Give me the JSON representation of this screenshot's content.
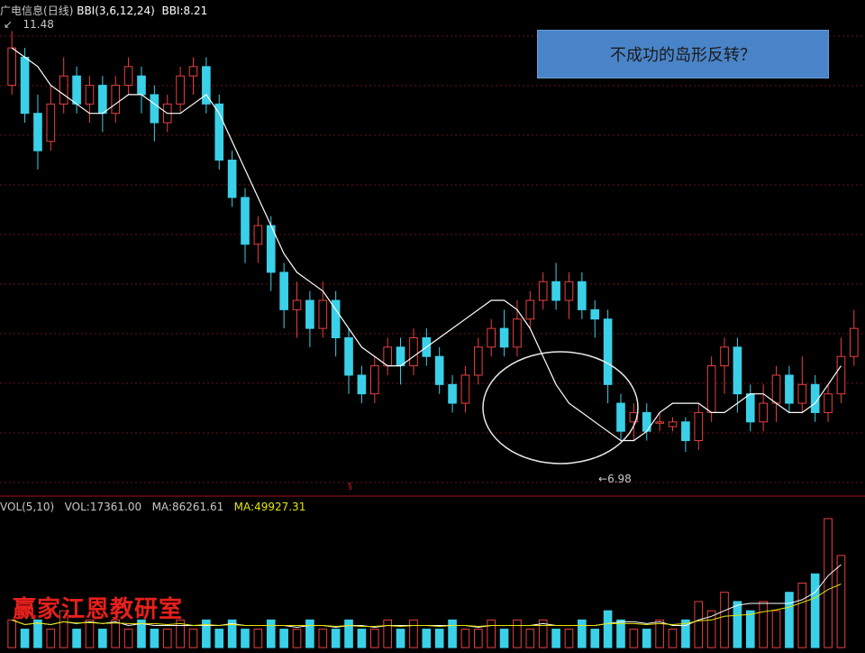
{
  "price_panel": {
    "stock_name": "广电信息",
    "period": "(日线)",
    "indicator": "BBI(3,6,12,24)",
    "bbi_label": "BBI:8.21",
    "high_marker": "11.48",
    "low_marker": "6.98"
  },
  "volume_panel": {
    "indicator": "VOL(5,10)",
    "vol_value": "VOL:17361.00",
    "ma1": "MA:86261.61",
    "ma2": "MA:49927.31",
    "panel_tag": "§"
  },
  "callout": {
    "text": "不成功的岛形反转？",
    "color": "#4a84c8"
  },
  "watermark": {
    "text": "赢家江恩教研室",
    "color": "#e8201c"
  },
  "colors": {
    "up": "#e84040",
    "down": "#3ad0e8",
    "bbi": "#ffffff",
    "grid": "#6a1515",
    "vol_ma1": "#ffffff",
    "vol_ma2": "#e6e600"
  },
  "chart_data": {
    "type": "candlestick",
    "title": "广电信息 (日线)",
    "y_range": [
      6.7,
      11.6
    ],
    "grid": true,
    "series": [
      {
        "name": "BBI",
        "values": [
          11.3,
          11.2,
          11.1,
          10.9,
          10.8,
          10.7,
          10.6,
          10.6,
          10.7,
          10.8,
          10.8,
          10.7,
          10.6,
          10.6,
          10.7,
          10.8,
          10.6,
          10.3,
          10.0,
          9.7,
          9.4,
          9.1,
          8.9,
          8.8,
          8.7,
          8.5,
          8.3,
          8.1,
          8.0,
          7.9,
          7.9,
          8.0,
          8.1,
          8.2,
          8.3,
          8.4,
          8.5,
          8.6,
          8.6,
          8.5,
          8.3,
          8.0,
          7.7,
          7.5,
          7.4,
          7.3,
          7.2,
          7.1,
          7.1,
          7.2,
          7.4,
          7.5,
          7.5,
          7.5,
          7.4,
          7.4,
          7.5,
          7.6,
          7.6,
          7.5,
          7.4,
          7.4,
          7.5,
          7.7,
          7.9
        ]
      },
      {
        "name": "VOL MA1",
        "values": []
      },
      {
        "name": "VOL MA2",
        "values": []
      }
    ],
    "candles": [
      {
        "o": 10.9,
        "c": 11.3,
        "h": 11.48,
        "l": 10.8
      },
      {
        "o": 11.2,
        "c": 10.6,
        "h": 11.3,
        "l": 10.5
      },
      {
        "o": 10.6,
        "c": 10.2,
        "h": 10.8,
        "l": 10.0
      },
      {
        "o": 10.3,
        "c": 10.7,
        "h": 10.9,
        "l": 10.2
      },
      {
        "o": 10.7,
        "c": 11.0,
        "h": 11.2,
        "l": 10.6
      },
      {
        "o": 11.0,
        "c": 10.7,
        "h": 11.1,
        "l": 10.6
      },
      {
        "o": 10.7,
        "c": 10.9,
        "h": 11.0,
        "l": 10.5
      },
      {
        "o": 10.9,
        "c": 10.6,
        "h": 11.0,
        "l": 10.4
      },
      {
        "o": 10.6,
        "c": 10.9,
        "h": 11.0,
        "l": 10.5
      },
      {
        "o": 10.9,
        "c": 11.1,
        "h": 11.2,
        "l": 10.8
      },
      {
        "o": 11.0,
        "c": 10.8,
        "h": 11.1,
        "l": 10.6
      },
      {
        "o": 10.8,
        "c": 10.5,
        "h": 10.9,
        "l": 10.3
      },
      {
        "o": 10.5,
        "c": 10.7,
        "h": 10.8,
        "l": 10.4
      },
      {
        "o": 10.7,
        "c": 11.0,
        "h": 11.1,
        "l": 10.6
      },
      {
        "o": 11.0,
        "c": 11.1,
        "h": 11.2,
        "l": 10.8
      },
      {
        "o": 11.1,
        "c": 10.7,
        "h": 11.2,
        "l": 10.6
      },
      {
        "o": 10.7,
        "c": 10.1,
        "h": 10.8,
        "l": 10.0
      },
      {
        "o": 10.1,
        "c": 9.7,
        "h": 10.2,
        "l": 9.6
      },
      {
        "o": 9.7,
        "c": 9.2,
        "h": 9.8,
        "l": 9.0
      },
      {
        "o": 9.2,
        "c": 9.4,
        "h": 9.5,
        "l": 9.0
      },
      {
        "o": 9.4,
        "c": 8.9,
        "h": 9.5,
        "l": 8.7
      },
      {
        "o": 8.9,
        "c": 8.5,
        "h": 9.0,
        "l": 8.3
      },
      {
        "o": 8.5,
        "c": 8.6,
        "h": 8.8,
        "l": 8.2
      },
      {
        "o": 8.6,
        "c": 8.3,
        "h": 8.7,
        "l": 8.1
      },
      {
        "o": 8.3,
        "c": 8.6,
        "h": 8.8,
        "l": 8.2
      },
      {
        "o": 8.6,
        "c": 8.2,
        "h": 8.7,
        "l": 8.0
      },
      {
        "o": 8.2,
        "c": 7.8,
        "h": 8.3,
        "l": 7.6
      },
      {
        "o": 7.8,
        "c": 7.6,
        "h": 7.9,
        "l": 7.5
      },
      {
        "o": 7.6,
        "c": 7.9,
        "h": 8.0,
        "l": 7.5
      },
      {
        "o": 7.9,
        "c": 8.1,
        "h": 8.2,
        "l": 7.8
      },
      {
        "o": 8.1,
        "c": 7.9,
        "h": 8.2,
        "l": 7.7
      },
      {
        "o": 7.9,
        "c": 8.2,
        "h": 8.3,
        "l": 7.8
      },
      {
        "o": 8.2,
        "c": 8.0,
        "h": 8.3,
        "l": 7.9
      },
      {
        "o": 8.0,
        "c": 7.7,
        "h": 8.1,
        "l": 7.6
      },
      {
        "o": 7.7,
        "c": 7.5,
        "h": 7.8,
        "l": 7.4
      },
      {
        "o": 7.5,
        "c": 7.8,
        "h": 7.9,
        "l": 7.4
      },
      {
        "o": 7.8,
        "c": 8.1,
        "h": 8.2,
        "l": 7.7
      },
      {
        "o": 8.1,
        "c": 8.3,
        "h": 8.4,
        "l": 8.0
      },
      {
        "o": 8.3,
        "c": 8.1,
        "h": 8.5,
        "l": 8.0
      },
      {
        "o": 8.1,
        "c": 8.4,
        "h": 8.6,
        "l": 8.0
      },
      {
        "o": 8.4,
        "c": 8.6,
        "h": 8.7,
        "l": 8.3
      },
      {
        "o": 8.6,
        "c": 8.8,
        "h": 8.9,
        "l": 8.5
      },
      {
        "o": 8.8,
        "c": 8.6,
        "h": 9.0,
        "l": 8.5
      },
      {
        "o": 8.6,
        "c": 8.8,
        "h": 8.9,
        "l": 8.4
      },
      {
        "o": 8.8,
        "c": 8.5,
        "h": 8.9,
        "l": 8.4
      },
      {
        "o": 8.5,
        "c": 8.4,
        "h": 8.6,
        "l": 8.2
      },
      {
        "o": 8.4,
        "c": 7.7,
        "h": 8.5,
        "l": 7.5
      },
      {
        "o": 7.5,
        "c": 7.2,
        "h": 7.6,
        "l": 7.1
      },
      {
        "o": 7.3,
        "c": 7.4,
        "h": 7.5,
        "l": 7.1
      },
      {
        "o": 7.4,
        "c": 7.2,
        "h": 7.5,
        "l": 7.1
      },
      {
        "o": 7.3,
        "c": 7.3,
        "h": 7.4,
        "l": 7.2
      },
      {
        "o": 7.25,
        "c": 7.3,
        "h": 7.35,
        "l": 7.2
      },
      {
        "o": 7.3,
        "c": 7.1,
        "h": 7.35,
        "l": 6.98
      },
      {
        "o": 7.1,
        "c": 7.4,
        "h": 7.5,
        "l": 7.0
      },
      {
        "o": 7.4,
        "c": 7.9,
        "h": 8.0,
        "l": 7.3
      },
      {
        "o": 7.9,
        "c": 8.1,
        "h": 8.2,
        "l": 7.6
      },
      {
        "o": 8.1,
        "c": 7.6,
        "h": 8.2,
        "l": 7.4
      },
      {
        "o": 7.6,
        "c": 7.3,
        "h": 7.7,
        "l": 7.2
      },
      {
        "o": 7.3,
        "c": 7.5,
        "h": 7.7,
        "l": 7.2
      },
      {
        "o": 7.5,
        "c": 7.8,
        "h": 7.9,
        "l": 7.3
      },
      {
        "o": 7.8,
        "c": 7.5,
        "h": 7.9,
        "l": 7.4
      },
      {
        "o": 7.5,
        "c": 7.7,
        "h": 8.0,
        "l": 7.4
      },
      {
        "o": 7.7,
        "c": 7.4,
        "h": 7.8,
        "l": 7.3
      },
      {
        "o": 7.4,
        "c": 7.6,
        "h": 7.7,
        "l": 7.3
      },
      {
        "o": 7.6,
        "c": 8.0,
        "h": 8.2,
        "l": 7.5
      },
      {
        "o": 8.0,
        "c": 8.3,
        "h": 8.5,
        "l": 7.9
      }
    ],
    "volume": [
      3,
      2,
      3,
      2,
      4,
      2,
      3,
      2,
      3,
      2,
      3,
      2,
      2,
      3,
      2,
      3,
      2,
      3,
      2,
      2,
      3,
      2,
      2,
      3,
      2,
      2,
      3,
      2,
      2,
      3,
      2,
      3,
      2,
      2,
      3,
      2,
      2,
      3,
      2,
      3,
      2,
      3,
      2,
      2,
      3,
      2,
      4,
      3,
      2,
      2,
      3,
      2,
      3,
      5,
      4,
      6,
      5,
      4,
      5,
      4,
      6,
      7,
      8,
      14,
      10
    ]
  }
}
